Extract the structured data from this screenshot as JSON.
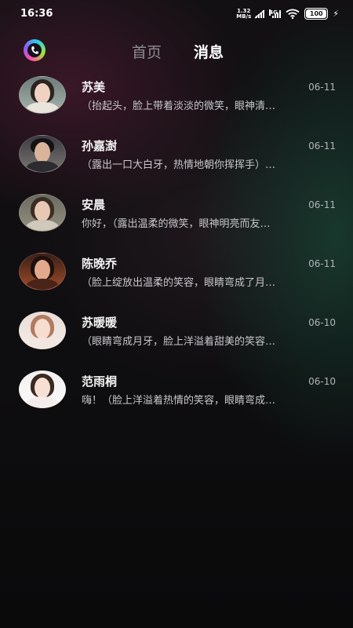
{
  "status_bar": {
    "time": "16:36",
    "net_speed_value": "1.32",
    "net_speed_unit": "MB/s",
    "network_type": "4G",
    "battery_level": "100",
    "charging_icon": "lightning-icon"
  },
  "header": {
    "logo_icon": "app-logo-icon",
    "tabs": [
      {
        "label": "首页",
        "active": false
      },
      {
        "label": "消息",
        "active": true
      }
    ]
  },
  "conversations": [
    {
      "name": "苏美",
      "date": "06-11",
      "preview": "（抬起头，脸上带着淡淡的微笑，眼神清…"
    },
    {
      "name": "孙嘉澍",
      "date": "06-11",
      "preview": "（露出一口大白牙，热情地朝你挥挥手）…"
    },
    {
      "name": "安晨",
      "date": "06-11",
      "preview": "你好，（露出温柔的微笑，眼神明亮而友…"
    },
    {
      "name": "陈晚乔",
      "date": "06-11",
      "preview": "（脸上绽放出温柔的笑容，眼睛弯成了月…"
    },
    {
      "name": "苏暖暖",
      "date": "06-10",
      "preview": "（眼睛弯成月牙，脸上洋溢着甜美的笑容…"
    },
    {
      "name": "范雨桐",
      "date": "06-10",
      "preview": "嗨！（脸上洋溢着热情的笑容，眼睛弯成…"
    }
  ],
  "colors": {
    "background": "#0b0a0c",
    "text_primary": "#f2f2f2",
    "text_secondary": "#c8c7cc",
    "tab_inactive": "#8e8c92"
  }
}
